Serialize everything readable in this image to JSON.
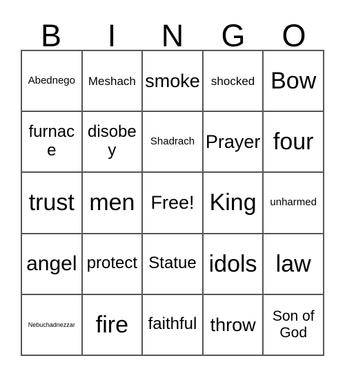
{
  "card": {
    "headers": [
      "B",
      "I",
      "N",
      "G",
      "O"
    ],
    "rows": [
      [
        {
          "text": "Abednego",
          "size": "xxs"
        },
        {
          "text": "Meshach",
          "size": "xs"
        },
        {
          "text": "smoke",
          "size": "lg"
        },
        {
          "text": "shocked",
          "size": "xs"
        },
        {
          "text": "Bow",
          "size": "xxl"
        }
      ],
      [
        {
          "text": "furnace",
          "size": "md"
        },
        {
          "text": "disobey",
          "size": "md"
        },
        {
          "text": "Shadrach",
          "size": "xxs"
        },
        {
          "text": "Prayer",
          "size": "lg"
        },
        {
          "text": "four",
          "size": "xxl"
        }
      ],
      [
        {
          "text": "trust",
          "size": "xxl"
        },
        {
          "text": "men",
          "size": "xxl"
        },
        {
          "text": "Free!",
          "size": "lg"
        },
        {
          "text": "King",
          "size": "xxl"
        },
        {
          "text": "unharmed",
          "size": "xxs"
        }
      ],
      [
        {
          "text": "angel",
          "size": "xl"
        },
        {
          "text": "protect",
          "size": "md"
        },
        {
          "text": "Statue",
          "size": "md"
        },
        {
          "text": "idols",
          "size": "xxl"
        },
        {
          "text": "law",
          "size": "xxl"
        }
      ],
      [
        {
          "text": "Nebuchadnezzar",
          "size": "tiny"
        },
        {
          "text": "fire",
          "size": "xxl"
        },
        {
          "text": "faithful",
          "size": "md"
        },
        {
          "text": "throw",
          "size": "lg"
        },
        {
          "text": "Son of God",
          "size": "sm"
        }
      ]
    ],
    "free_space": "Free!",
    "colors": {
      "border": "#555555",
      "text": "#000000",
      "background": "#ffffff"
    }
  }
}
